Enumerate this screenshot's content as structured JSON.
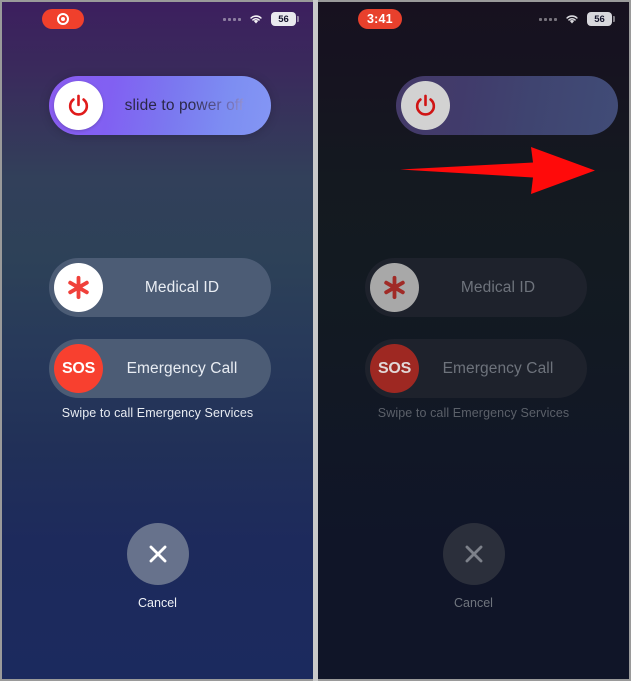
{
  "screen": {
    "title": "iPhone Power Off / SOS screen",
    "panel_count": 2
  },
  "panels": [
    {
      "id": "before",
      "state": "normal-brightness",
      "status_bar": {
        "recording_indicator": "recording-dot",
        "recording_label": "",
        "signal_icon": "signal-dots-icon",
        "wifi_icon": "wifi-icon",
        "battery_level": "56"
      },
      "power_slider": {
        "label": "slide to power off",
        "knob_icon": "power-icon",
        "knob_position": "left"
      },
      "medical_id": {
        "label": "Medical ID",
        "icon": "medical-asterisk-icon"
      },
      "emergency_call": {
        "label": "Emergency Call",
        "icon": "sos-icon",
        "icon_text": "SOS"
      },
      "swipe_note": "Swipe to call Emergency Services",
      "cancel": {
        "label": "Cancel",
        "icon": "close-x-icon"
      }
    },
    {
      "id": "after",
      "state": "dimmed",
      "status_bar": {
        "recording_indicator": "recording-timer",
        "recording_label": "3:41",
        "signal_icon": "signal-dots-icon",
        "wifi_icon": "wifi-icon",
        "battery_level": "56"
      },
      "power_slider": {
        "label": "",
        "knob_icon": "power-icon",
        "knob_position": "center"
      },
      "medical_id": {
        "label": "Medical ID",
        "icon": "medical-asterisk-icon"
      },
      "emergency_call": {
        "label": "Emergency Call",
        "icon": "sos-icon",
        "icon_text": "SOS"
      },
      "swipe_note": "Swipe to call Emergency Services",
      "cancel": {
        "label": "Cancel",
        "icon": "close-x-icon"
      }
    }
  ],
  "annotation": {
    "arrow_icon": "right-arrow-annotation",
    "arrow_color": "#ff0a0a",
    "direction": "right"
  },
  "colors": {
    "slider_accent": "#8160f2",
    "sos_red": "#f8402f",
    "recording_red": "#f0402c",
    "pill_slate": "#4c5c75",
    "cancel_gray": "#67728c"
  }
}
